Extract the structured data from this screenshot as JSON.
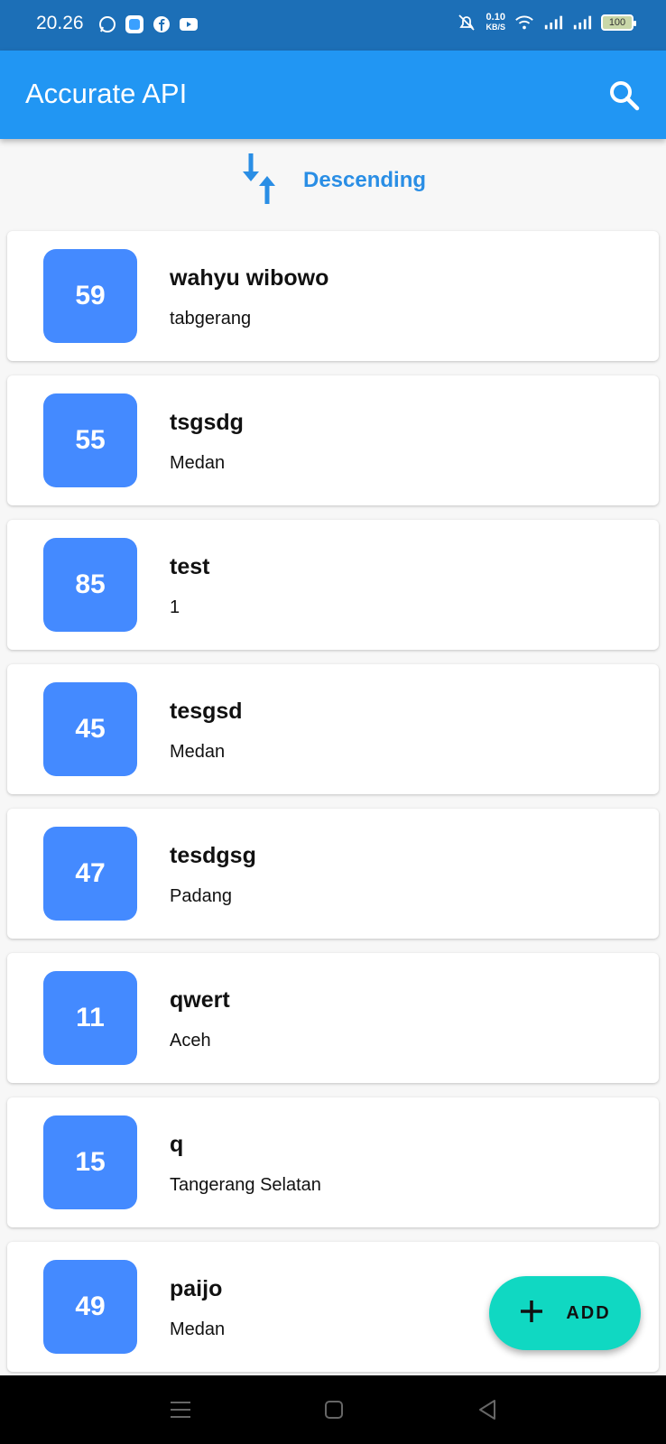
{
  "status_bar": {
    "time": "20.26",
    "net_speed_value": "0.10",
    "net_speed_unit": "KB/S",
    "battery": "100"
  },
  "app_bar": {
    "title": "Accurate API"
  },
  "sort": {
    "label": "Descending"
  },
  "items": [
    {
      "number": "59",
      "name": "wahyu wibowo",
      "city": "tabgerang"
    },
    {
      "number": "55",
      "name": "tsgsdg",
      "city": "Medan"
    },
    {
      "number": "85",
      "name": "test",
      "city": "1"
    },
    {
      "number": "45",
      "name": "tesgsd",
      "city": "Medan"
    },
    {
      "number": "47",
      "name": "tesdgsg",
      "city": "Padang"
    },
    {
      "number": "11",
      "name": "qwert",
      "city": "Aceh"
    },
    {
      "number": "15",
      "name": "q",
      "city": "Tangerang Selatan"
    },
    {
      "number": "49",
      "name": "paijo",
      "city": "Medan"
    }
  ],
  "fab": {
    "label": "ADD"
  },
  "colors": {
    "status_bar": "#1c6fb7",
    "app_bar": "#2196f3",
    "badge": "#448aff",
    "fab": "#10d8c2",
    "sort_text": "#2a8ee5"
  }
}
